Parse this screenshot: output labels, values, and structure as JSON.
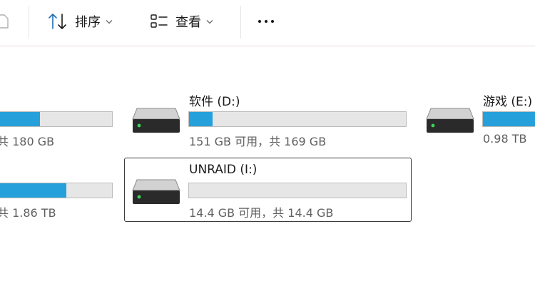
{
  "toolbar": {
    "sort_label": "排序",
    "view_label": "查看",
    "icons": {
      "partial_left": "partial-icon",
      "sort": "sort-arrows-icon",
      "view": "list-view-icon",
      "chevron": "chevron-down-icon",
      "more": "more-horizontal-icon"
    }
  },
  "drives": [
    {
      "name": "",
      "capacity": "共 180 GB",
      "used_fraction": 0.37,
      "selected": false
    },
    {
      "name": "软件 (D:)",
      "capacity": "151 GB 可用，共 169 GB",
      "used_fraction": 0.11,
      "selected": false
    },
    {
      "name": "游戏 (E:)",
      "capacity": "0.98 TB",
      "used_fraction": 1.0,
      "selected": false
    },
    {
      "name": "",
      "capacity": "共 1.86 TB",
      "used_fraction": 0.6,
      "selected": false
    },
    {
      "name": "UNRAID (I:)",
      "capacity": "14.4 GB 可用，共 14.4 GB",
      "used_fraction": 0.0,
      "selected": true
    }
  ],
  "colors": {
    "bar_fill": "#26a0da",
    "bar_track": "#e6e6e6",
    "led_green": "#3bd45a"
  }
}
